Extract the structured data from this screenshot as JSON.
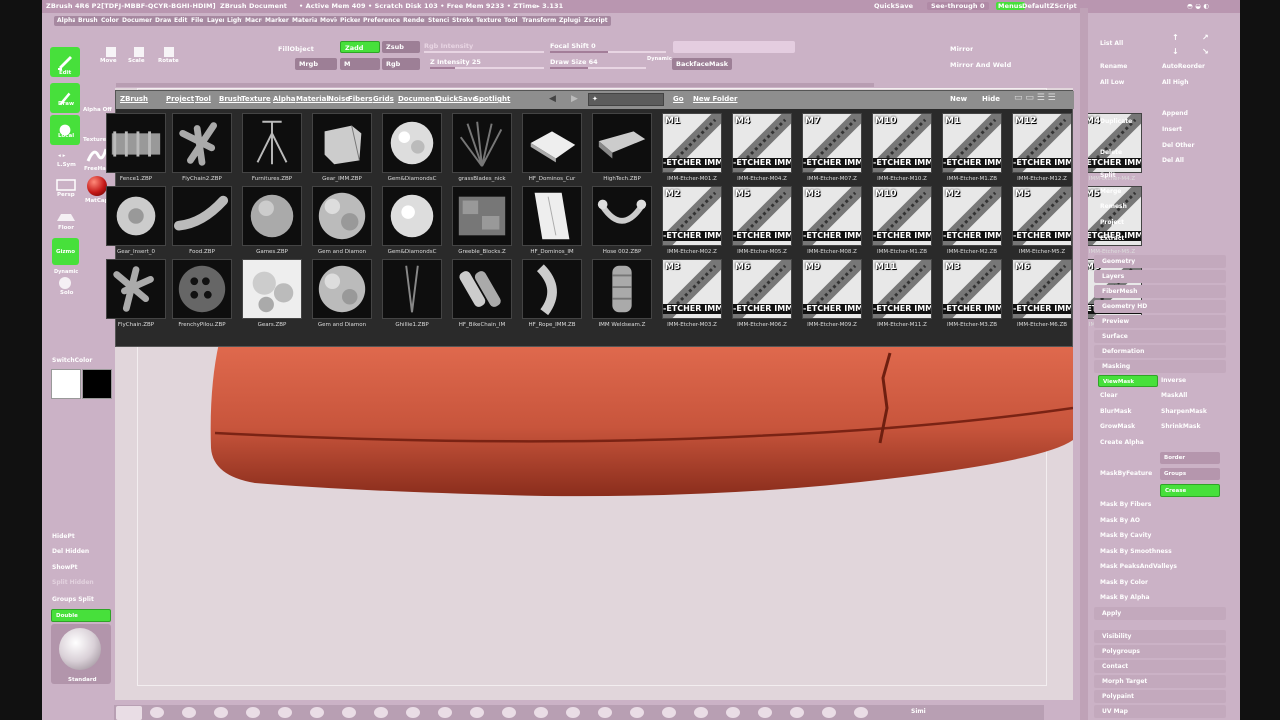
{
  "title": {
    "app": "ZBrush 4R6 P2[TDFJ-MBBF-QCYR-BGHI-HDIM]",
    "doc": "ZBrush Document",
    "status": "• Active Mem 409 • Scratch Disk 103 • Free Mem 9233 • ZTime▸ 3.131",
    "quicksave": "QuickSave",
    "seethrough": "See-through 0",
    "menus_label": "Menus",
    "script": "DefaultZScript"
  },
  "menus": [
    "Alpha",
    "Brush",
    "Color",
    "Document",
    "Draw",
    "Edit",
    "File",
    "Layer",
    "Light",
    "Macro",
    "Marker",
    "Material",
    "Movie",
    "Picker",
    "Preferences",
    "Render",
    "Stencil",
    "Stroke",
    "Texture",
    "Tool",
    "Transform",
    "Zplugin",
    "Zscript"
  ],
  "toolbar": {
    "edit": "Edit",
    "move": "Move",
    "scale": "Scale",
    "rotate": "Rotate",
    "fillobject": "FillObject",
    "zadd": "Zadd",
    "zsub": "Zsub",
    "mrgb": "Mrgb",
    "m": "M",
    "rgb": "Rgb",
    "rgb_intensity": "Rgb Intensity",
    "z_intensity": "Z Intensity 25",
    "focal_shift": "Focal Shift 0",
    "draw_size": "Draw Size 64",
    "dynamic": "Dynamic",
    "backfacemask": "BackfaceMask",
    "mirror": "Mirror",
    "mirror_weld": "Mirror And Weld"
  },
  "shelf": {
    "edit": "Edit",
    "draw": "Draw",
    "alpha_off": "Alpha Off",
    "local": "Local",
    "texture_off": "Texture Off",
    "lsym": "L.Sym",
    "freehand": "FreeHand",
    "matcap": "MatCap R",
    "persp": "Persp",
    "floor": "Floor",
    "gizmo": "Gizmo",
    "dynamic": "Dynamic",
    "solo": "Solo",
    "switchcolor": "SwitchColor",
    "hidept": "HidePt",
    "del_hidden": "Del Hidden",
    "showpt": "ShowPt",
    "split_hidden": "Split Hidden",
    "groups_split": "Groups Split",
    "double": "Double",
    "standard": "Standard"
  },
  "popup": {
    "tabs": [
      "ZBrush",
      "Project",
      "Tool",
      "Brush",
      "Texture",
      "Alpha",
      "Material",
      "Noise",
      "Fibers",
      "Grids",
      "Document",
      "QuickSave",
      "Spotlight"
    ],
    "go": "Go",
    "new_folder": "New Folder",
    "new": "New",
    "hide": "Hide",
    "row1": [
      "Fence1.ZBP",
      "FlyChain2.ZBP",
      "Furnitures.ZBP",
      "Gear_IMM.ZBP",
      "Gem&DiamondsC",
      "grassBlades_nick",
      "HF_Dominos_Cur",
      "HighTech.ZBP"
    ],
    "row2": [
      "Gear_Insert_0",
      "Food.ZBP",
      "Games.ZBP",
      "Gem and Diamon",
      "Gem&DiamondsC",
      "Greeble_Blocks.Z",
      "HF_Dominos_IM",
      "Hose 002.ZBP"
    ],
    "row3": [
      "FlyChain.ZBP",
      "FrenchyPilou.ZBP",
      "Gears.ZBP",
      "Gem and Diamon",
      "Ghillie1.ZBP",
      "HF_BikeChain_IM",
      "HF_Rope_IMM.ZB",
      "IMM Weldseam.Z"
    ],
    "etcher_band": "-ETCHER IMM-",
    "etch_row1": [
      {
        "m": "M1",
        "l": "IMM-Etcher-M01.Z"
      },
      {
        "m": "M4",
        "l": "IMM-Etcher-M04.Z"
      },
      {
        "m": "M7",
        "l": "IMM-Etcher-M07.Z"
      },
      {
        "m": "M10",
        "l": "IMM-Etcher-M10.Z"
      },
      {
        "m": "M1",
        "l": "IMM-Etcher-M1.ZB"
      },
      {
        "m": "M12",
        "l": "IMM-Etcher-M12.Z"
      },
      {
        "m": "M4",
        "l": "IMM-Etcher-M4.Z"
      }
    ],
    "etch_row2": [
      {
        "m": "M2",
        "l": "IMM-Etcher-M02.Z"
      },
      {
        "m": "M5",
        "l": "IMM-Etcher-M05.Z"
      },
      {
        "m": "M8",
        "l": "IMM-Etcher-M08.Z"
      },
      {
        "m": "M10",
        "l": "IMM-Etcher-M1.ZB"
      },
      {
        "m": "M2",
        "l": "IMM-Etcher-M2.ZB"
      },
      {
        "m": "M5",
        "l": "IMM-Etcher-M5.Z"
      },
      {
        "m": "M5",
        "l": "IMM-Etcher-M5.Z"
      }
    ],
    "etch_row3": [
      {
        "m": "M3",
        "l": "IMM-Etcher-M03.Z"
      },
      {
        "m": "M6",
        "l": "IMM-Etcher-M06.Z"
      },
      {
        "m": "M9",
        "l": "IMM-Etcher-M09.Z"
      },
      {
        "m": "M11",
        "l": "IMM-Etcher-M11.Z"
      },
      {
        "m": "M3",
        "l": "IMM-Etcher-M3.ZB"
      },
      {
        "m": "M6",
        "l": "IMM-Etcher-M6.ZB"
      },
      {
        "m": "M6",
        "l": "IMM-Etcher-M6.Z"
      }
    ]
  },
  "right": {
    "list_all": "List All",
    "rename": "Rename",
    "autoreorder": "AutoReorder",
    "all_low": "All Low",
    "all_high": "All High",
    "append": "Append",
    "duplicate": "Duplicate",
    "insert": "Insert",
    "delete": "Delete",
    "del_other": "Del Other",
    "del_all": "Del All",
    "split": "Split",
    "merge": "Merge",
    "remesh": "Remesh",
    "project": "Project",
    "extract": "Extract",
    "sections": [
      "Geometry",
      "Layers",
      "FiberMesh",
      "Geometry HD",
      "Preview",
      "Surface",
      "Deformation"
    ],
    "masking": "Masking",
    "viewmask": "ViewMask",
    "inverse": "Inverse",
    "clear": "Clear",
    "maskall": "MaskAll",
    "blurmask": "BlurMask",
    "sharpenmask": "SharpenMask",
    "growmask": "GrowMask",
    "shrinkmask": "ShrinkMask",
    "create_alpha": "Create Alpha",
    "border": "Border",
    "maskbyfeature": "MaskByFeature",
    "groups": "Groups",
    "crease": "Crease",
    "mask_items": [
      "Mask By Fibers",
      "Mask By AO",
      "Mask By Cavity",
      "Mask By Smoothness",
      "Mask PeaksAndValleys",
      "Mask By Color",
      "Mask By Alpha"
    ],
    "apply": "Apply",
    "sections2": [
      "Visibility",
      "Polygroups",
      "Contact",
      "Morph Target",
      "Polypaint",
      "UV Map"
    ]
  },
  "bottom": {
    "sim": "Simi"
  },
  "colors": {
    "accent_green": "#47e03b",
    "ui_pink": "#cbb2c6",
    "model_red": "#c8553c"
  }
}
